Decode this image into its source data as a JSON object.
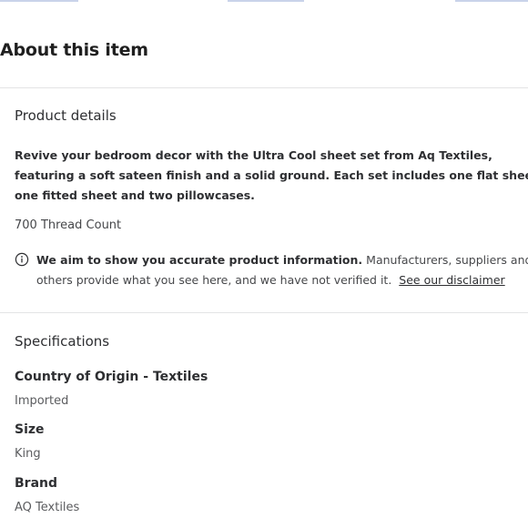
{
  "about": {
    "title": "About this item"
  },
  "product_details": {
    "heading": "Product details",
    "description": "Revive your bedroom decor with the Ultra Cool sheet set from Aq Textiles, featuring a soft sateen finish and a solid ground. Each set includes one flat sheet, one fitted sheet and two pillowcases.",
    "thread_count": "700 Thread Count",
    "info_icon": "info-circle-icon",
    "notice_strong": "We aim to show you accurate product information.",
    "notice_text": "Manufacturers, suppliers and others provide what you see here, and we have not verified it.",
    "notice_link": "See our disclaimer"
  },
  "specifications": {
    "heading": "Specifications",
    "items": [
      {
        "label": "Country of Origin - Textiles",
        "value": "Imported"
      },
      {
        "label": "Size",
        "value": "King"
      },
      {
        "label": "Brand",
        "value": "AQ Textiles"
      }
    ]
  }
}
